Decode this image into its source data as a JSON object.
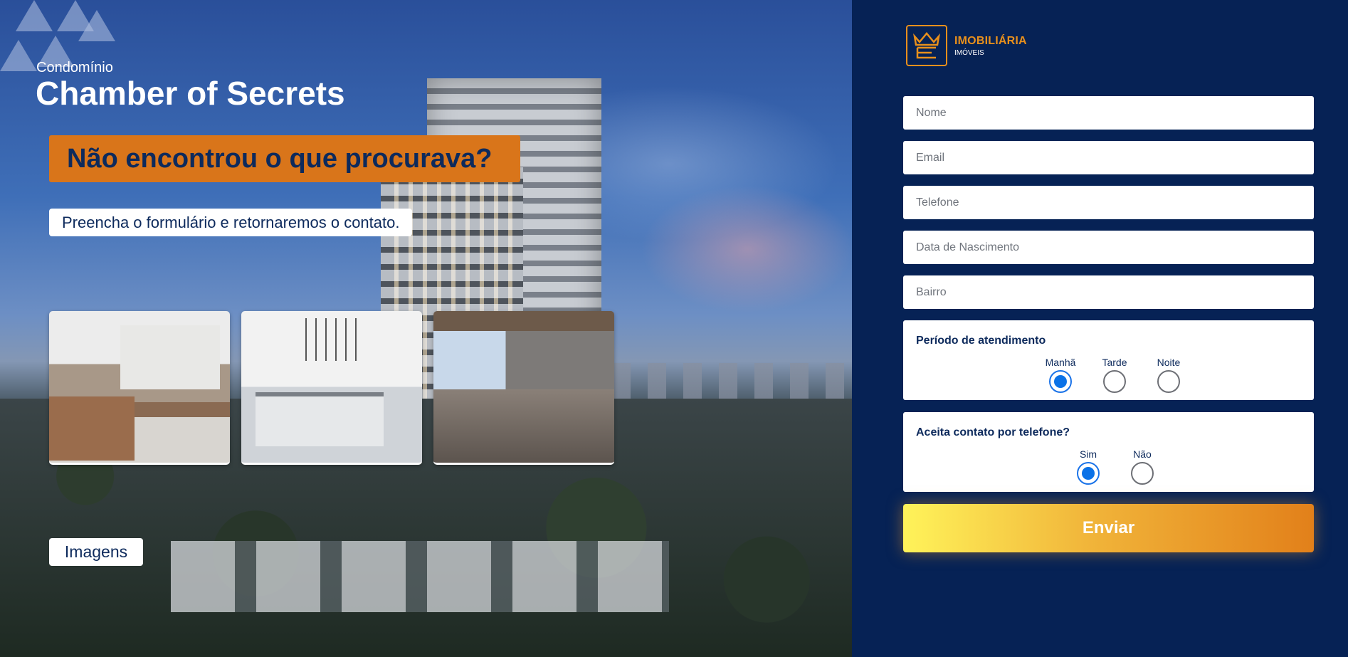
{
  "hero": {
    "small_title": "Condomínio",
    "title": "Chamber of Secrets",
    "banner": "Não encontrou o que procurava?",
    "subtext": "Preencha o formulário e retornaremos o contato.",
    "images_button": "Imagens",
    "gallery": [
      "kitchen-photo",
      "kitchen-island-photo",
      "balcony-photo"
    ]
  },
  "logo": {
    "title": "IMOBILIÁRIA",
    "subtitle": "IMÓVEIS",
    "accent_color": "#e8901c"
  },
  "form": {
    "nome_placeholder": "Nome",
    "email_placeholder": "Email",
    "telefone_placeholder": "Telefone",
    "nascimento_placeholder": "Data de Nascimento",
    "bairro_placeholder": "Bairro",
    "periodo": {
      "title": "Período de atendimento",
      "options": [
        "Manhã",
        "Tarde",
        "Noite"
      ],
      "selected": "Manhã"
    },
    "contato": {
      "title": "Aceita contato por telefone?",
      "options": [
        "Sim",
        "Não"
      ],
      "selected": "Sim"
    },
    "submit": "Enviar"
  },
  "colors": {
    "panel_bg": "#062255",
    "banner_bg": "#d9751a",
    "radio_selected": "#0b72e7"
  }
}
